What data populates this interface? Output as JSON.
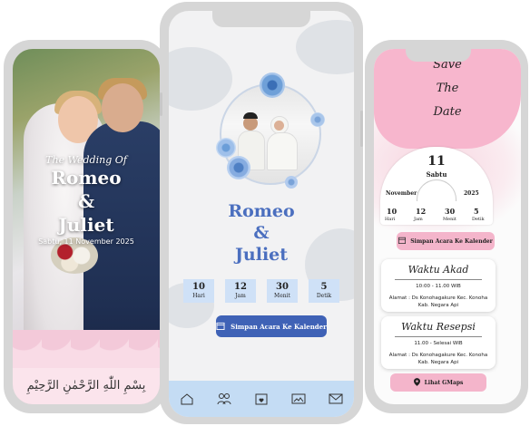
{
  "left_phone": {
    "script_title": "The Wedding Of",
    "groom": "Romeo",
    "amp": "&",
    "bride": "Juliet",
    "date": "Sabtu, 11 November 2025",
    "basmalah": "بِسْمِ اللّٰهِ الرَّحْمٰنِ الرَّحِيْمِ"
  },
  "middle_phone": {
    "groom": "Romeo",
    "amp": "&",
    "bride": "Juliet",
    "countdown": [
      {
        "value": "10",
        "unit": "Hari"
      },
      {
        "value": "12",
        "unit": "Jam"
      },
      {
        "value": "30",
        "unit": "Menit"
      },
      {
        "value": "5",
        "unit": "Detik"
      }
    ],
    "calendar_button": "Simpan Acara Ke Kalender",
    "nav": [
      "home-icon",
      "couple-icon",
      "calendar-heart-icon",
      "gallery-icon",
      "mail-icon"
    ]
  },
  "right_phone": {
    "save": "Save",
    "the": "The",
    "date_word": "Date",
    "day_number": "11",
    "day_name": "Sabtu",
    "month": "November",
    "year": "2025",
    "countdown": [
      {
        "value": "10",
        "unit": "Hari"
      },
      {
        "value": "12",
        "unit": "Jam"
      },
      {
        "value": "30",
        "unit": "Menit"
      },
      {
        "value": "5",
        "unit": "Detik"
      }
    ],
    "calendar_button": "Simpan Acara Ke Kalender",
    "events": [
      {
        "title": "Waktu Akad",
        "time": "10:00 - 11.00 WIB",
        "address": "Alamat : Ds Konohagakure Kec. Konoha Kab. Negara Api"
      },
      {
        "title": "Waktu Resepsi",
        "time": "11.00 - Selesai WIB",
        "address": "Alamat : Ds Konohagakure Kec. Konoha Kab. Negara Api"
      }
    ],
    "maps_button": "Lihat GMaps"
  },
  "colors": {
    "accent_blue": "#3f62b6",
    "title_blue": "#4b6fbf",
    "pink": "#f4b5cb",
    "count_box": "#cfe1f7"
  }
}
